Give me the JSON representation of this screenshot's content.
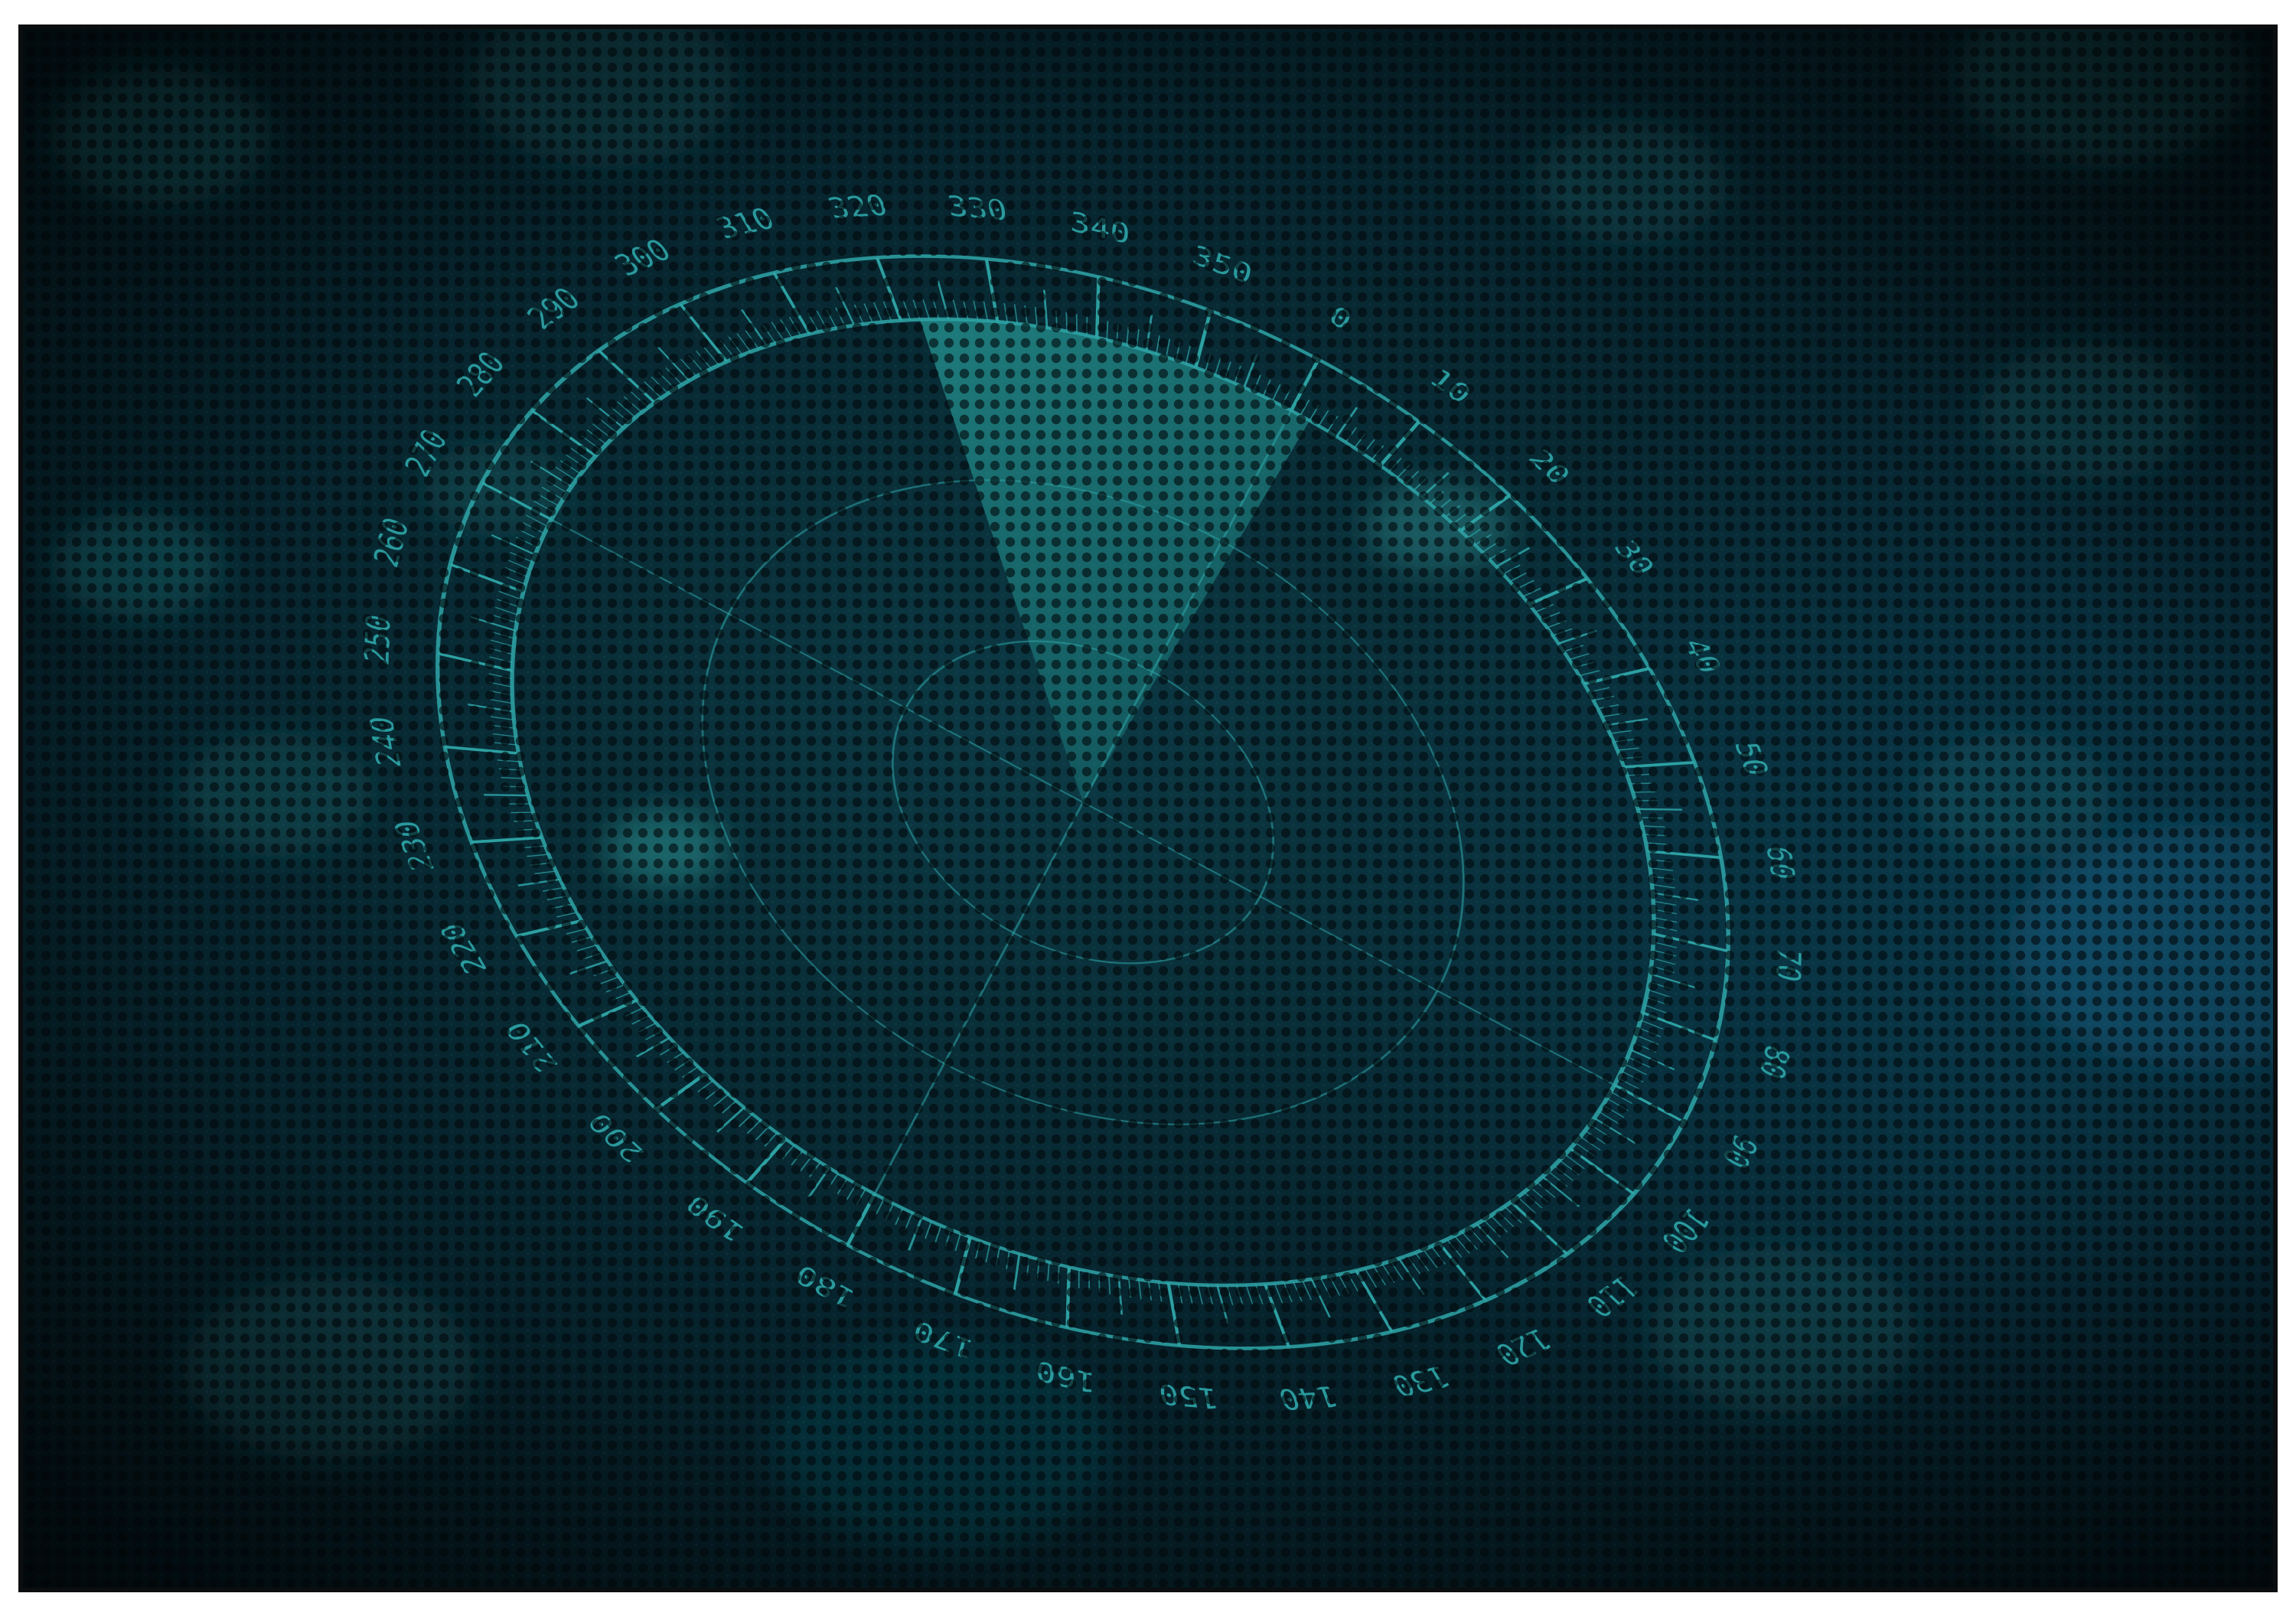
{
  "scope": {
    "bearing_labels": [
      "0",
      "10",
      "20",
      "30",
      "40",
      "50",
      "60",
      "70",
      "80",
      "90",
      "100",
      "110",
      "120",
      "130",
      "140",
      "150",
      "160",
      "170",
      "180",
      "190",
      "200",
      "210",
      "220",
      "230",
      "240",
      "250",
      "260",
      "270",
      "280",
      "290",
      "300",
      "310",
      "320",
      "330",
      "340",
      "350"
    ],
    "sweep_heading_deg": 0,
    "colors": {
      "background": "#05141a",
      "accent": "#2fa6a8",
      "sweep": "#1f8f8c",
      "glow": "#0e5d66",
      "frame": "#0b0d0e"
    }
  }
}
